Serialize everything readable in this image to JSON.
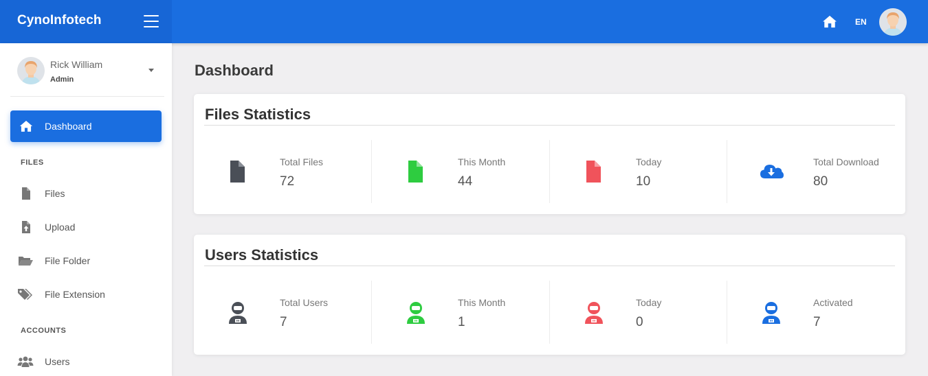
{
  "header": {
    "brand": "CynoInfotech",
    "language": "EN"
  },
  "user": {
    "name": "Rick William",
    "role": "Admin"
  },
  "sidebar": {
    "active_item": {
      "label": "Dashboard",
      "icon": "home-icon"
    },
    "sections": [
      {
        "title": "FILES",
        "items": [
          {
            "label": "Files",
            "icon": "file-icon"
          },
          {
            "label": "Upload",
            "icon": "file-upload-icon"
          },
          {
            "label": "File Folder",
            "icon": "folder-open-icon"
          },
          {
            "label": "File Extension",
            "icon": "tags-icon"
          }
        ]
      },
      {
        "title": "ACCOUNTS",
        "items": [
          {
            "label": "Users",
            "icon": "users-icon"
          }
        ]
      }
    ]
  },
  "page": {
    "title": "Dashboard"
  },
  "files_stats": {
    "title": "Files Statistics",
    "items": [
      {
        "label": "Total Files",
        "value": "72",
        "icon": "file-icon",
        "color": "#4a4f57"
      },
      {
        "label": "This Month",
        "value": "44",
        "icon": "file-icon",
        "color": "#2ecc40"
      },
      {
        "label": "Today",
        "value": "10",
        "icon": "file-icon",
        "color": "#f0535b"
      },
      {
        "label": "Total Download",
        "value": "80",
        "icon": "cloud-download-icon",
        "color": "#1a6ee0"
      }
    ]
  },
  "users_stats": {
    "title": "Users Statistics",
    "items": [
      {
        "label": "Total Users",
        "value": "7",
        "icon": "user-astronaut-icon",
        "color": "#4a4f57"
      },
      {
        "label": "This Month",
        "value": "1",
        "icon": "user-astronaut-icon",
        "color": "#2ecc40"
      },
      {
        "label": "Today",
        "value": "0",
        "icon": "user-astronaut-icon",
        "color": "#f0535b"
      },
      {
        "label": "Activated",
        "value": "7",
        "icon": "user-astronaut-icon",
        "color": "#1a6ee0"
      }
    ]
  },
  "colors": {
    "primary": "#1a6ee0",
    "brand_bg": "#1766d6",
    "page_bg": "#f0eff1"
  }
}
